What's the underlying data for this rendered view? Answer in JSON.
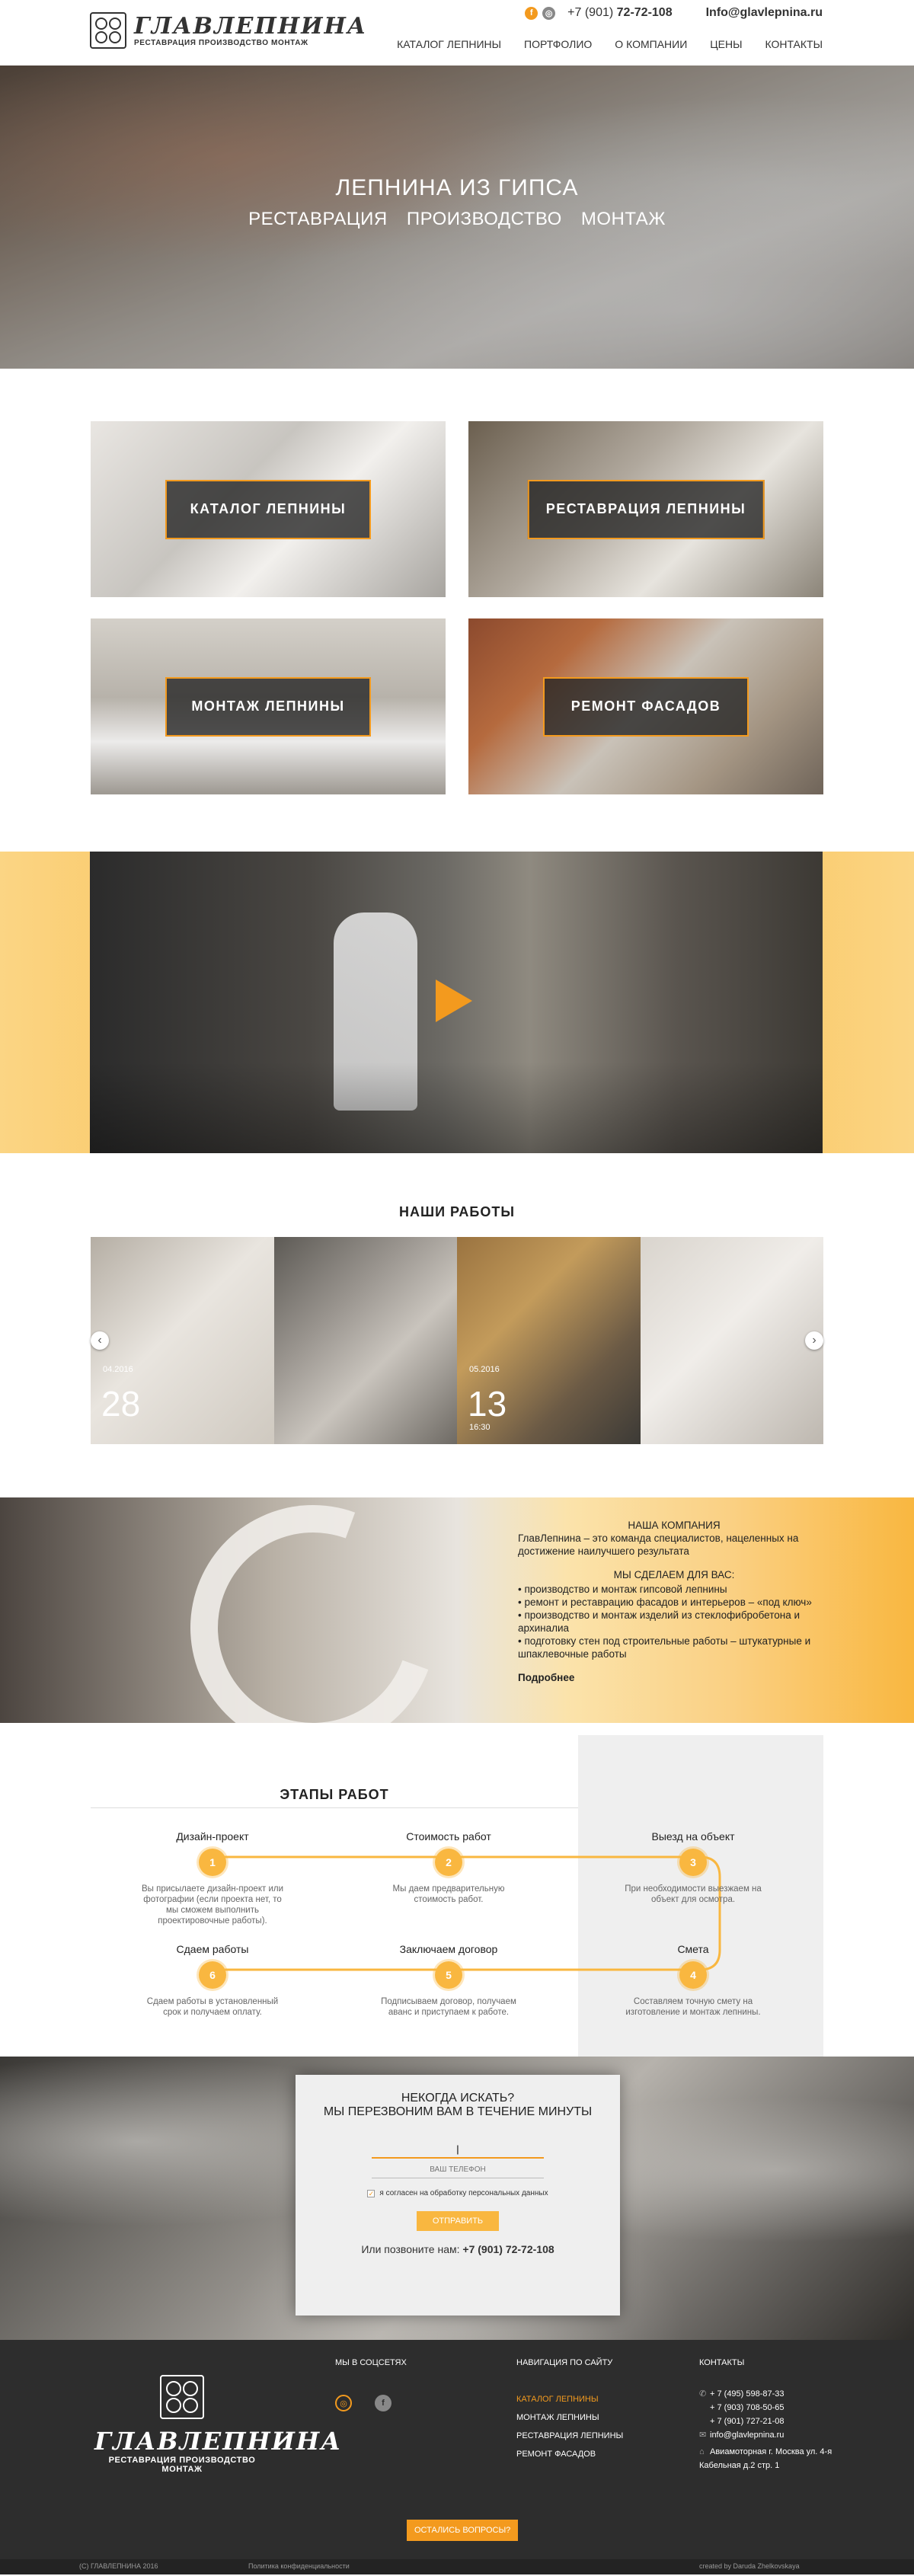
{
  "header": {
    "brand_name": "ГЛАВЛЕПНИНА",
    "brand_tagline": "РЕСТАВРАЦИЯ ПРОИЗВОДСТВО МОНТАЖ",
    "phone_prefix": "+7 (901)",
    "phone_number": "72-72-108",
    "email": "Info@glavlepnina.ru",
    "nav": [
      "КАТАЛОГ ЛЕПНИНЫ",
      "ПОРТФОЛИО",
      "О КОМПАНИИ",
      "ЦЕНЫ",
      "КОНТАКТЫ"
    ]
  },
  "hero": {
    "title": "ЛЕПНИНА ИЗ ГИПСА",
    "subtitle": "РЕСТАВРАЦИЯ ПРОИЗВОДСТВО МОНТАЖ"
  },
  "tiles": [
    "КАТАЛОГ ЛЕПНИНЫ",
    "РЕСТАВРАЦИЯ ЛЕПНИНЫ",
    "МОНТАЖ ЛЕПНИНЫ",
    "РЕМОНТ ФАСАДОВ"
  ],
  "works": {
    "title": "НАШИ РАБОТЫ",
    "slides": [
      {
        "month": "04.2016",
        "day": "28",
        "time": ""
      },
      {
        "month": "",
        "day": "",
        "time": ""
      },
      {
        "month": "05.2016",
        "day": "13",
        "time": "16:30"
      },
      {
        "month": "",
        "day": "",
        "time": ""
      }
    ]
  },
  "company": {
    "heading": "НАША КОМПАНИЯ",
    "intro": "ГлавЛепнина – это команда специалистов, нацеленных на достижение наилучшего результата",
    "we_do": "МЫ СДЕЛАЕМ ДЛЯ ВАС:",
    "items": [
      "производство и монтаж гипсовой лепнины",
      "ремонт и реставрацию фасадов и интерьеров – «под ключ»",
      "производство и монтаж изделий из стеклофибробетона и архиналиа",
      "подготовку стен под строительные работы – штукатурные и шпаклевочные работы"
    ],
    "more": "Подробнее"
  },
  "steps": {
    "title": "ЭТАПЫ РАБОТ",
    "items": [
      {
        "num": "1",
        "title": "Дизайн-проект",
        "desc": "Вы присылаете дизайн-проект или фотографии (если проекта нет, то мы сможем выполнить проектировочные работы)."
      },
      {
        "num": "2",
        "title": "Стоимость работ",
        "desc": "Мы даем предварительную стоимость работ."
      },
      {
        "num": "3",
        "title": "Выезд на объект",
        "desc": "При необходимости выезжаем на объект для осмотра."
      },
      {
        "num": "4",
        "title": "Смета",
        "desc": "Составляем точную смету на изготовление и монтаж лепнины."
      },
      {
        "num": "5",
        "title": "Заключаем договор",
        "desc": "Подписываем договор, получаем аванс и приступаем к работе."
      },
      {
        "num": "6",
        "title": "Сдаем работы",
        "desc": "Сдаем работы в установленный срок и получаем оплату."
      }
    ]
  },
  "callback": {
    "title": "НЕКОГДА ИСКАТЬ?\nМЫ ПЕРЕЗВОНИМ ВАМ В ТЕЧЕНИЕ МИНУТЫ",
    "name_value": "|",
    "phone_placeholder": "ВАШ ТЕЛЕФОН",
    "consent": "я согласен на обработку персональных данных",
    "submit": "ОТПРАВИТЬ",
    "call_prefix": "Или позвоните нам:",
    "call_phone": "+7 (901) 72-72-108"
  },
  "footer": {
    "brand_name": "ГЛАВЛЕПНИНА",
    "brand_tagline": "РЕСТАВРАЦИЯ ПРОИЗВОДСТВО МОНТАЖ",
    "social_title": "МЫ В СОЦСЕТЯХ",
    "nav_title": "НАВИГАЦИЯ ПО САЙТУ",
    "nav": [
      "КАТАЛОГ ЛЕПНИНЫ",
      "МОНТАЖ ЛЕПНИНЫ",
      "РЕСТАВРАЦИЯ ЛЕПНИНЫ",
      "РЕМОНТ ФАСАДОВ"
    ],
    "contacts_title": "КОНТАКТЫ",
    "phones": [
      "+ 7 (495) 598-87-33",
      "+ 7 (903) 708-50-65",
      "+ 7 (901) 727-21-08"
    ],
    "email": "info@glavlepnina.ru",
    "address": "Авиамоторная г. Москва ул. 4-я Кабельная д.2 стр. 1",
    "ask_button": "ОСТАЛИСЬ ВОПРОСЫ?",
    "copyright": "(C) ГЛАВЛЕПНИНА 2016",
    "privacy": "Политика конфиденциальности",
    "credits": "created by Daruda Zhelkovskaya"
  },
  "colors": {
    "accent": "#f39a1e",
    "accent_light": "#f9b740",
    "footer_bg": "#2d2d2d"
  }
}
